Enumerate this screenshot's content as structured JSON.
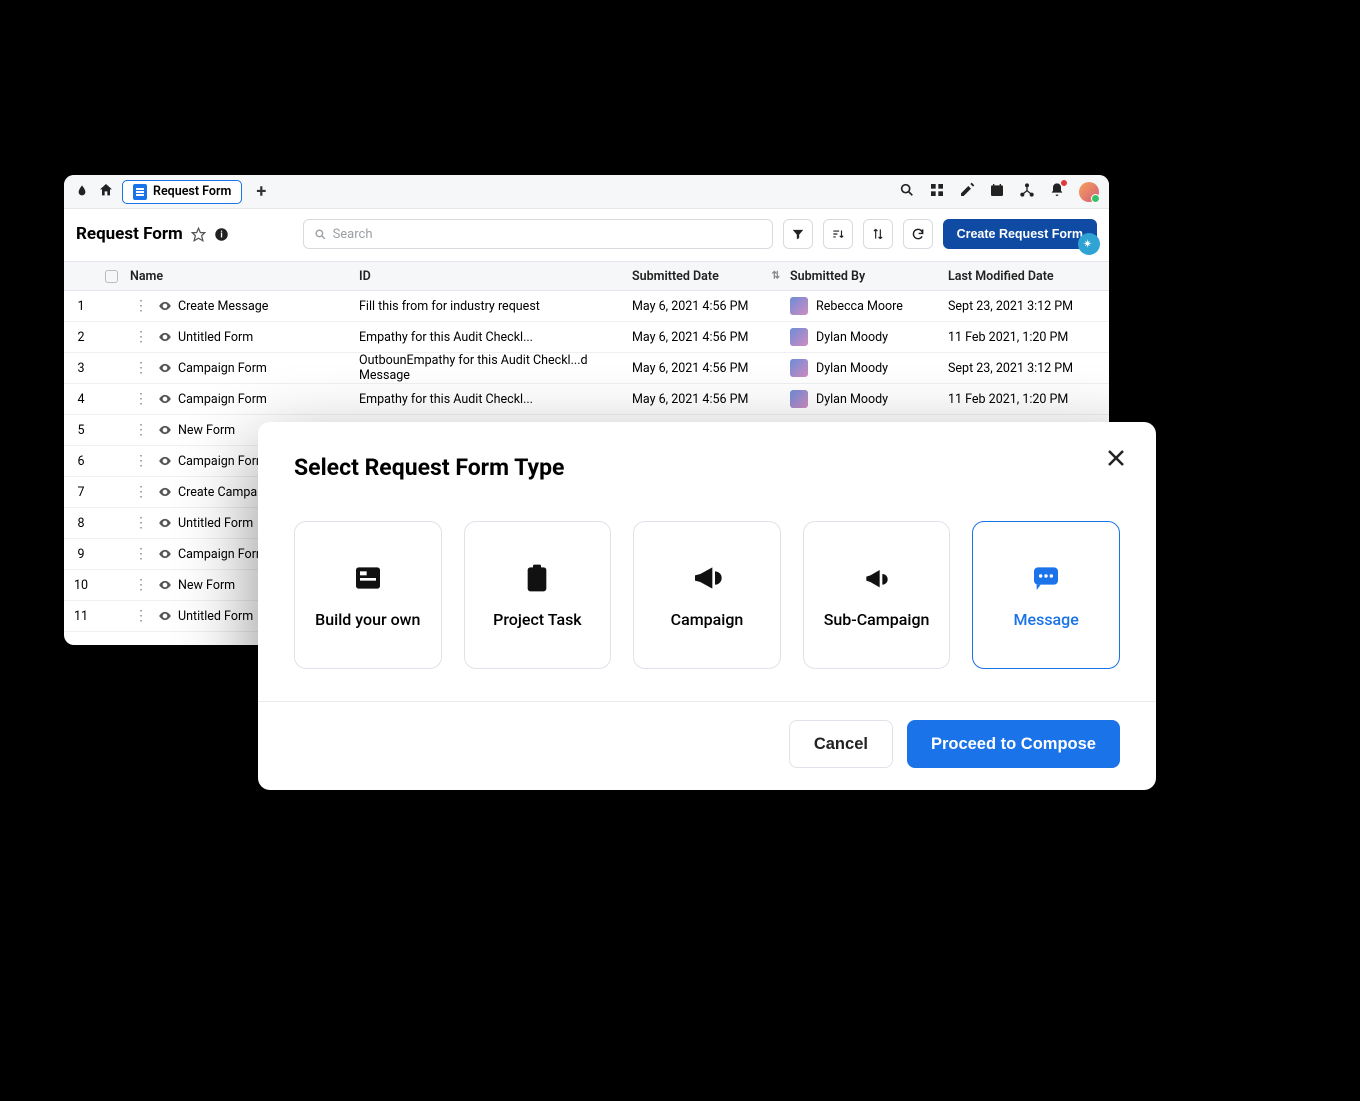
{
  "tab_label": "Request Form",
  "page_title": "Request Form",
  "search_placeholder": "Search",
  "create_button": "Create Request Form",
  "columns": {
    "name": "Name",
    "id": "ID",
    "submitted": "Submitted Date",
    "by": "Submitted By",
    "modified": "Last Modified Date"
  },
  "rows": [
    {
      "n": "1",
      "name": "Create Message",
      "id": "Fill this from for industry request",
      "sub": "May 6, 2021 4:56 PM",
      "by": "Rebecca Moore",
      "mod": "Sept 23, 2021 3:12 PM"
    },
    {
      "n": "2",
      "name": "Untitled Form",
      "id": "Empathy for this Audit Checkl...",
      "sub": "May 6, 2021 4:56 PM",
      "by": "Dylan Moody",
      "mod": "11 Feb 2021, 1:20 PM"
    },
    {
      "n": "3",
      "name": "Campaign Form",
      "id": "OutbounEmpathy for this Audit Checkl...d Message",
      "sub": "May 6, 2021 4:56 PM",
      "by": "Dylan Moody",
      "mod": "Sept 23, 2021 3:12 PM"
    },
    {
      "n": "4",
      "name": "Campaign Form",
      "id": "Empathy for this Audit Checkl...",
      "sub": "May 6, 2021 4:56 PM",
      "by": "Dylan Moody",
      "mod": "11 Feb 2021, 1:20 PM"
    },
    {
      "n": "5",
      "name": "New Form",
      "id": "",
      "sub": "",
      "by": "",
      "mod": ""
    },
    {
      "n": "6",
      "name": "Campaign Form",
      "id": "",
      "sub": "",
      "by": "",
      "mod": ""
    },
    {
      "n": "7",
      "name": "Create Campaign",
      "id": "",
      "sub": "",
      "by": "",
      "mod": ""
    },
    {
      "n": "8",
      "name": "Untitled Form",
      "id": "",
      "sub": "",
      "by": "",
      "mod": ""
    },
    {
      "n": "9",
      "name": "Campaign Form",
      "id": "",
      "sub": "",
      "by": "",
      "mod": ""
    },
    {
      "n": "10",
      "name": "New Form",
      "id": "",
      "sub": "",
      "by": "",
      "mod": ""
    },
    {
      "n": "11",
      "name": "Untitled Form",
      "id": "",
      "sub": "",
      "by": "",
      "mod": ""
    }
  ],
  "modal": {
    "title": "Select Request Form Type",
    "types": {
      "build": "Build your own",
      "project": "Project Task",
      "campaign": "Campaign",
      "sub": "Sub-Campaign",
      "message": "Message"
    },
    "cancel": "Cancel",
    "proceed": "Proceed to Compose"
  }
}
